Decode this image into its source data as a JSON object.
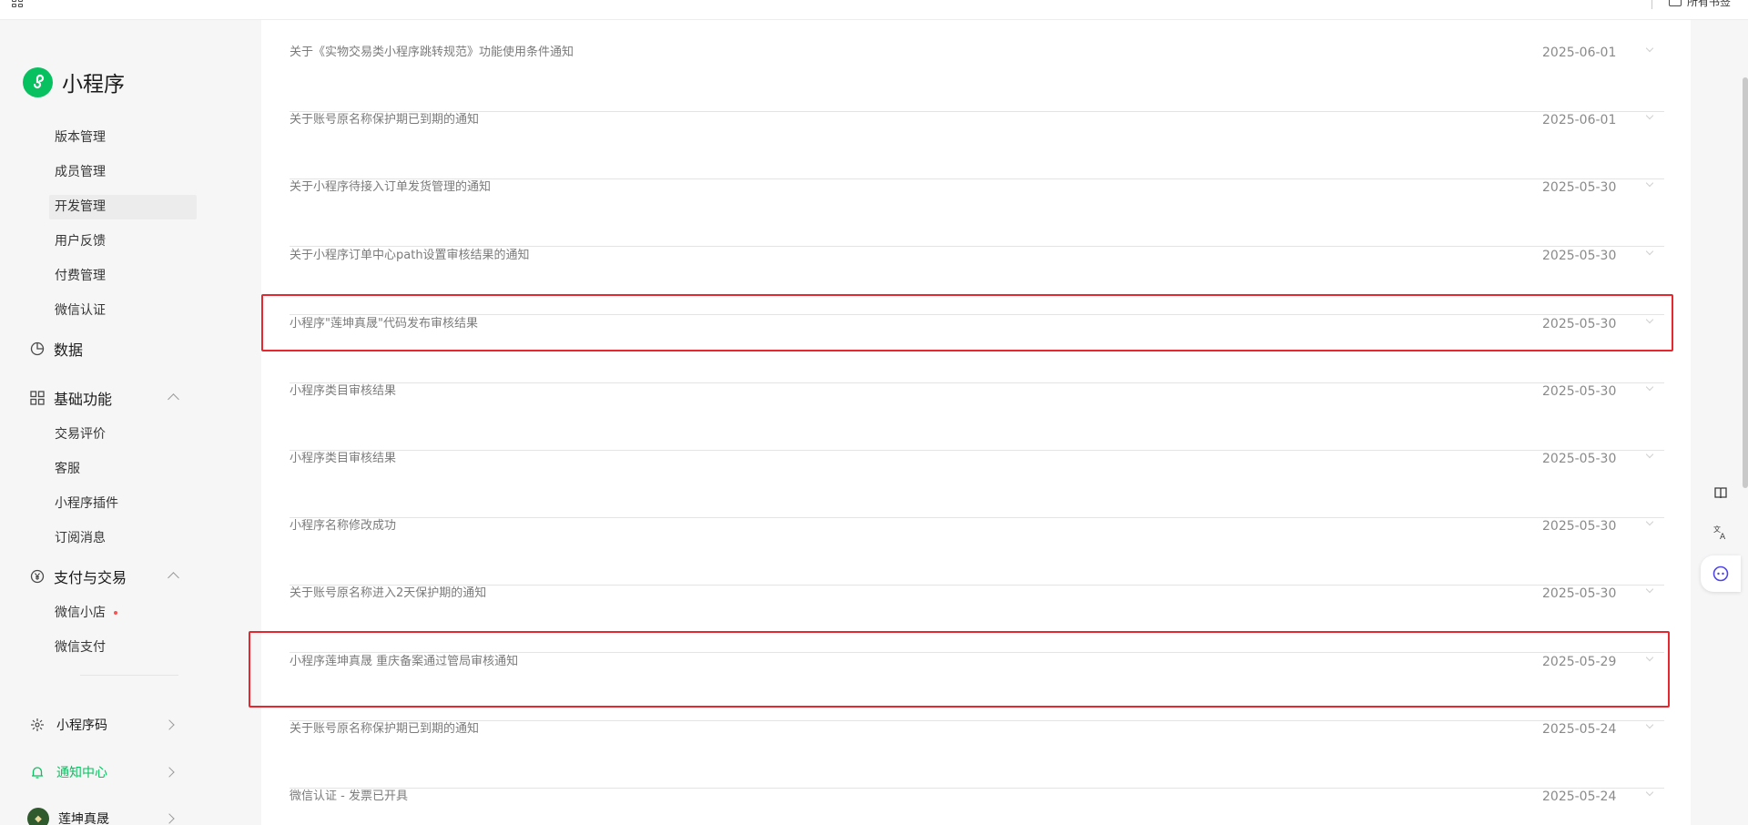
{
  "browser": {
    "bookmarks_label": "所有书签"
  },
  "sidebar": {
    "brand_name": "小程序",
    "sub_items_top": [
      {
        "label": "版本管理"
      },
      {
        "label": "成员管理"
      },
      {
        "label": "开发管理",
        "active": true
      },
      {
        "label": "用户反馈"
      },
      {
        "label": "付费管理"
      },
      {
        "label": "微信认证"
      }
    ],
    "data_group": "数据",
    "basic_group": "基础功能",
    "basic_items": [
      {
        "label": "交易评价"
      },
      {
        "label": "客服"
      },
      {
        "label": "小程序插件"
      },
      {
        "label": "订阅消息"
      }
    ],
    "pay_group": "支付与交易",
    "pay_items": [
      {
        "label": "微信小店",
        "badge_dot": true
      },
      {
        "label": "微信支付"
      }
    ],
    "bottom_items": [
      {
        "label": "小程序码",
        "icon": "qr-code-icon"
      },
      {
        "label": "通知中心",
        "icon": "bell-icon",
        "active": true
      },
      {
        "label": "莲坤真晟",
        "icon": "avatar"
      }
    ]
  },
  "notices": [
    {
      "title": "关于《实物交易类小程序跳转规范》功能使用条件通知",
      "date": "2025-06-01"
    },
    {
      "title": "关于账号原名称保护期已到期的通知",
      "date": "2025-06-01"
    },
    {
      "title": "关于小程序待接入订单发货管理的通知",
      "date": "2025-05-30"
    },
    {
      "title": "关于小程序订单中心path设置审核结果的通知",
      "date": "2025-05-30"
    },
    {
      "title": "小程序\"莲坤真晟\"代码发布审核结果",
      "date": "2025-05-30",
      "highlighted": true
    },
    {
      "title": "小程序类目审核结果",
      "date": "2025-05-30"
    },
    {
      "title": "小程序类目审核结果",
      "date": "2025-05-30"
    },
    {
      "title": "小程序名称修改成功",
      "date": "2025-05-30"
    },
    {
      "title": "关于账号原名称进入2天保护期的通知",
      "date": "2025-05-30"
    },
    {
      "title": "小程序莲坤真晟 重庆备案通过管局审核通知",
      "date": "2025-05-29",
      "highlighted": true
    },
    {
      "title": "关于账号原名称保护期已到期的通知",
      "date": "2025-05-24"
    },
    {
      "title": "微信认证 - 发票已开具",
      "date": "2025-05-24"
    }
  ],
  "float_tools": [
    {
      "icon": "book-icon"
    },
    {
      "icon": "translate-icon"
    },
    {
      "icon": "ai-assistant-icon"
    }
  ],
  "colors": {
    "brand_green": "#07c160",
    "highlight_red": "#e5272f",
    "badge_red": "#fa5151"
  }
}
